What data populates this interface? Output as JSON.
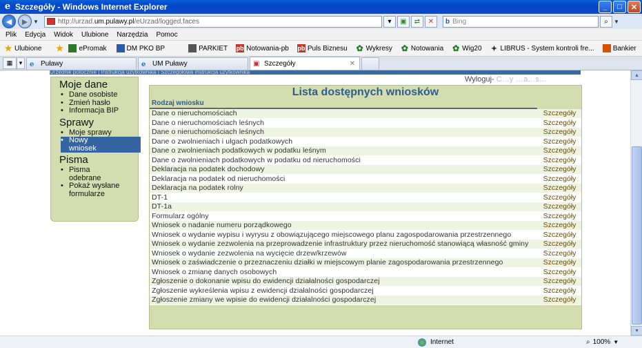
{
  "window": {
    "title": "Szczegóły - Windows Internet Explorer"
  },
  "address": {
    "url_prefix": "http://urzad.",
    "url_domain": "um.pulawy.pl",
    "url_suffix": "/eUrzad/logged.faces",
    "search_placeholder": "Bing",
    "search_brand": "b"
  },
  "menu": [
    "Plik",
    "Edycja",
    "Widok",
    "Ulubione",
    "Narzędzia",
    "Pomoc"
  ],
  "favorites": {
    "label": "Ulubione",
    "items": [
      {
        "label": "ePromak",
        "color": "#2b7a2b"
      },
      {
        "label": "DM PKO BP",
        "color": "#2a5aa8"
      },
      {
        "label": "PARKIET",
        "color": "#333333"
      },
      {
        "label": "Notowania-pb",
        "color": "#c0392b"
      },
      {
        "label": "Puls Biznesu",
        "color": "#c0392b"
      },
      {
        "label": "Wykresy",
        "color": "#1e7a1e"
      },
      {
        "label": "Notowania",
        "color": "#1e7a1e"
      },
      {
        "label": "Wig20",
        "color": "#1e7a1e"
      },
      {
        "label": "LIBRUS - System kontroli fre...",
        "color": "#333333"
      },
      {
        "label": "Bankier",
        "color": "#d35400"
      }
    ]
  },
  "tabs": [
    {
      "label": "Puławy"
    },
    {
      "label": "UM Puławy"
    },
    {
      "label": "Szczegóły"
    }
  ],
  "topstrip_text": "Urzędnik potocznie | Instrukcja użytkownika | Szczegółowa instrukcja użytkownika",
  "logout": {
    "label": "Wyloguj- ",
    "user": "C...y ...a...s..."
  },
  "sidebar": {
    "moje_dane": {
      "title": "Moje dane",
      "items": [
        "Dane osobiste",
        "Zmień hasło",
        "Informacja BIP"
      ]
    },
    "sprawy": {
      "title": "Sprawy",
      "items": [
        "Moje sprawy"
      ],
      "selected": "Nowy wniosek"
    },
    "pisma": {
      "title": "Pisma",
      "items": [
        "Pisma odebrane",
        "Pokaż wysłane formularze"
      ]
    }
  },
  "panel": {
    "title": "Lista dostępnych wniosków",
    "column_header": "Rodzaj wniosku",
    "action_label": "Szczegóły",
    "rows": [
      "Dane o nieruchomościach",
      "Dane o nieruchomościach leśnych",
      "Dane o nieruchomościach leśnych",
      "Dane o zwolnieniach i ulgach podatkowych",
      "Dane o zwolnieniach podatkowych w podatku leśnym",
      "Dane o zwolnieniach podatkowych w podatku od nieruchomości",
      "Deklaracja na podatek dochodowy",
      "Deklaracja na podatek od nieruchomości",
      "Deklaracja na podatek rolny",
      "DT-1",
      "DT-1a",
      "Formularz ogólny",
      "Wniosek o nadanie numeru porządkowego",
      "Wniosek o wydanie wypisu i wyrysu z obowiązującego miejscowego planu zagospodarowania przestrzennego",
      "Wniosek o wydanie zezwolenia na przeprowadzenie infrastruktury przez nieruchomość stanowiącą własność gminy",
      "Wniosek o wydanie zezwolenia na wycięcie drzew/krzewów",
      "Wniosek o zaświadczenie o przeznaczeniu działki w miejscowym planie zagospodarowania przestrzennego",
      "Wniosek o zmianę danych osobowych",
      "Zgłoszenie o dokonanie wpisu do ewidencji działalności gospodarczej",
      "Zgłoszenie wykreślenia wpisu z ewidencji działalności gospodarczej",
      "Zgłoszenie zmiany we wpisie do ewidencji działalności gospodarczej"
    ]
  },
  "status": {
    "zone": "Internet",
    "zoom": "100%"
  }
}
